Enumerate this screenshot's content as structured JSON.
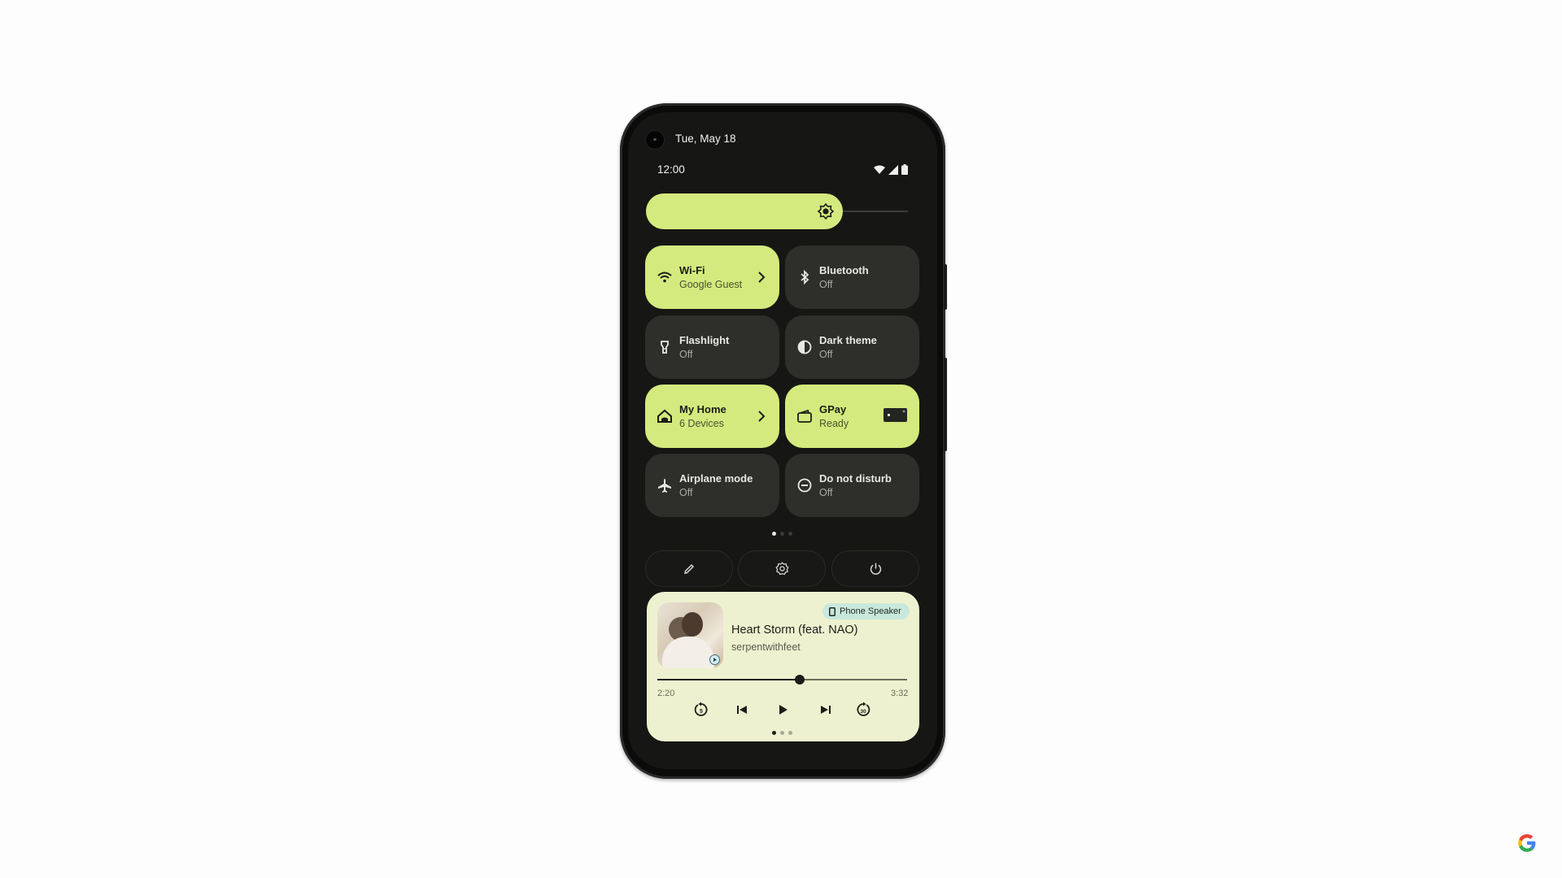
{
  "header": {
    "date": "Tue, May 18",
    "time": "12:00",
    "status_icons": [
      "wifi-icon",
      "signal-icon",
      "battery-icon"
    ]
  },
  "brightness": {
    "level_percent": 75,
    "icon": "brightness-icon"
  },
  "tiles": [
    {
      "label": "Wi-Fi",
      "sub": "Google Guest",
      "icon": "wifi-icon",
      "active": true,
      "has_chevron": true
    },
    {
      "label": "Bluetooth",
      "sub": "Off",
      "icon": "bluetooth-icon",
      "active": false
    },
    {
      "label": "Flashlight",
      "sub": "Off",
      "icon": "flashlight-icon",
      "active": false
    },
    {
      "label": "Dark theme",
      "sub": "Off",
      "icon": "dark-theme-icon",
      "active": false
    },
    {
      "label": "My Home",
      "sub": "6 Devices",
      "icon": "home-icon",
      "active": true,
      "has_chevron": true
    },
    {
      "label": "GPay",
      "sub": "Ready",
      "icon": "wallet-icon",
      "active": true,
      "has_card": true
    },
    {
      "label": "Airplane mode",
      "sub": "Off",
      "icon": "airplane-icon",
      "active": false
    },
    {
      "label": "Do not disturb",
      "sub": "Off",
      "icon": "do-not-disturb-icon",
      "active": false
    }
  ],
  "tile_pages": {
    "count": 3,
    "active": 0
  },
  "quick_actions": [
    {
      "name": "edit",
      "icon": "pencil-icon"
    },
    {
      "name": "settings",
      "icon": "gear-icon"
    },
    {
      "name": "power",
      "icon": "power-icon"
    }
  ],
  "media": {
    "output_chip": "Phone Speaker",
    "title": "Heart Storm (feat. NAO)",
    "artist": "serpentwithfeet",
    "elapsed": "2:20",
    "duration": "3:32",
    "progress_percent": 57,
    "controls": [
      "replay-5-icon",
      "skip-previous-icon",
      "play-icon",
      "skip-next-icon",
      "forward-30-icon"
    ],
    "pages": {
      "count": 3,
      "active": 0
    }
  },
  "colors": {
    "accent": "#d4ea7e",
    "tile_off": "#2e2f2b",
    "background": "#161714",
    "media_card": "#eef1cf",
    "chip": "#c9e8dc"
  }
}
